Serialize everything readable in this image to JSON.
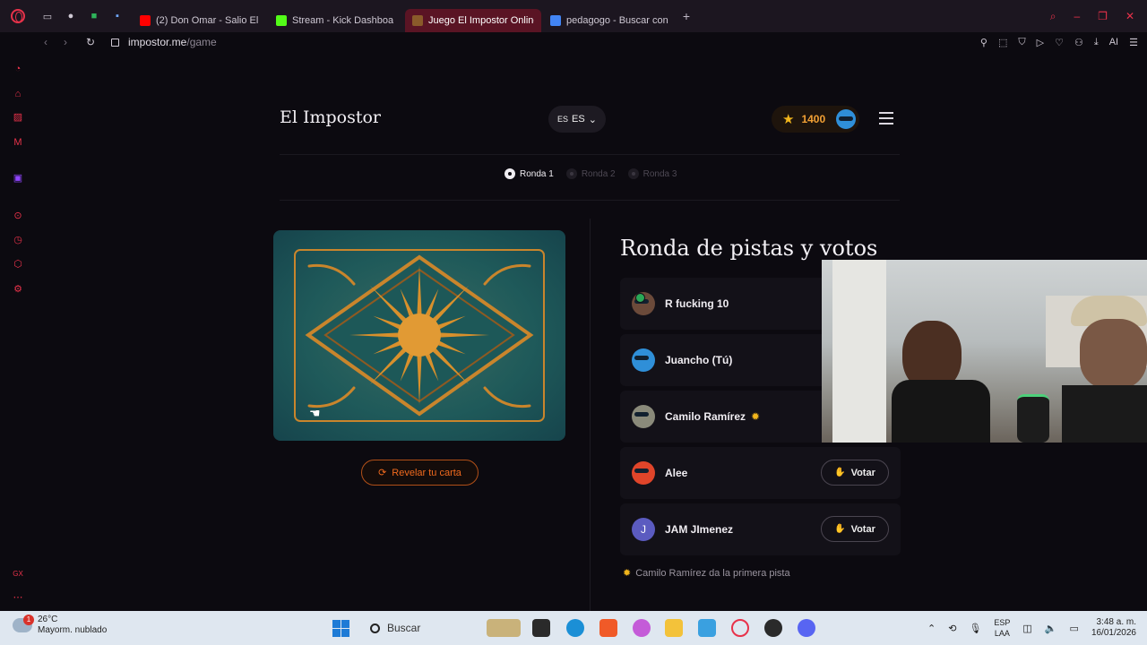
{
  "browser": {
    "tabs": [
      {
        "label": "(2) Don Omar - Salio El",
        "favicon_color": "#ff0000",
        "active": false
      },
      {
        "label": "Stream - Kick Dashboa",
        "favicon_color": "#53fc18",
        "active": false
      },
      {
        "label": "Juego El Impostor Online",
        "favicon_color": "#8a5a2a",
        "active": true
      },
      {
        "label": "pedagogo - Buscar con Go",
        "favicon_color": "#4285f4",
        "active": false
      }
    ],
    "new_tab": "+",
    "address": {
      "domain": "impostor.me",
      "path": "/game"
    },
    "ai_label": "AI"
  },
  "header": {
    "site_title": "El Impostor",
    "lang_flag": "ES",
    "lang_code": "ES",
    "coins": "1400"
  },
  "rounds": [
    {
      "label": "Ronda 1",
      "active": true
    },
    {
      "label": "Ronda 2",
      "active": false
    },
    {
      "label": "Ronda 3",
      "active": false
    }
  ],
  "card": {
    "reveal_label": "Revelar tu carta"
  },
  "section": {
    "title": "Ronda de pistas y votos"
  },
  "players": [
    {
      "name": "R fucking 10",
      "avatar_color": "#6b4a3a",
      "checked": true,
      "sun": false,
      "vote": ""
    },
    {
      "name": "Juancho (Tú)",
      "avatar_color": "#2f8fd8",
      "checked": false,
      "sun": false,
      "vote": ""
    },
    {
      "name": "Camilo Ramírez",
      "avatar_color": "#8a8a7a",
      "checked": false,
      "sun": true,
      "vote": ""
    },
    {
      "name": "Alee",
      "avatar_color": "#e0452a",
      "checked": false,
      "sun": false,
      "vote": "Votar"
    },
    {
      "name": "JAM JImenez",
      "avatar_color": "#5b5bc0",
      "avatar_letter": "J",
      "checked": false,
      "sun": false,
      "vote": "Votar"
    }
  ],
  "hint": "Camilo Ramírez da la primera pista",
  "taskbar": {
    "weather_temp": "26°C",
    "weather_desc": "Mayorm. nublado",
    "weather_alert": "1",
    "search_label": "Buscar",
    "lang_top": "ESP",
    "lang_bottom": "LAA",
    "time": "3:48 a. m.",
    "date": "16/01/2026"
  }
}
